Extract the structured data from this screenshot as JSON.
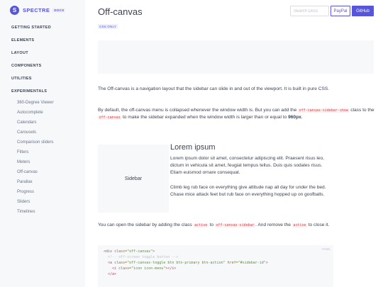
{
  "brand": {
    "logo_letter": "S",
    "name": "SPECTRE",
    "badge": "DOCS"
  },
  "sidebar": {
    "sections": [
      "GETTING STARTED",
      "ELEMENTS",
      "LAYOUT",
      "COMPONENTS",
      "UTILITIES",
      "EXPERIMENTALS"
    ],
    "items": [
      "360-Degree Viewer",
      "Autocomplete",
      "Calendars",
      "Carousels",
      "Comparison sliders",
      "Filters",
      "Meters",
      "Off-canvas",
      "Parallax",
      "Progress",
      "Sliders",
      "Timelines"
    ]
  },
  "header": {
    "search_placeholder": "Search Docs",
    "paypal_label": "PayPal",
    "github_label": "GitHub"
  },
  "main": {
    "title": "Off-canvas",
    "badge": "CSS ONLY",
    "intro": "The Off-canvas is a navigation layout that the sidebar can slide in and out of the viewport. It is built in pure CSS.",
    "default_p1": "By default, the off-canvas menu is collapsed whenever the window width is. But you can add the",
    "default_code1": "off-canvas-sidebar-show",
    "default_p2": "class to the",
    "default_code2": "off-canvas",
    "default_p3": "to make the sidebar expanded when the window width is larger than or equal to",
    "default_bold": "960px",
    "default_p4": ".",
    "demo": {
      "sidebar_label": "Sidebar",
      "heading": "Lorem ipsum",
      "p1": "Lorem ipsum dolor sit amet, consectetur adipiscing elit. Praesent risus leo, dictum in vehicula sit amet, feugiat tempus tellus. Duis quis sodales risus. Etiam euismod ornare consequat.",
      "p2": "Climb leg rub face on everything give attitude nap all day for under the bed. Chase mice attack feet but rub face on everything hopped up on goofballs."
    },
    "open_p1": "You can open the sidebar by adding the class",
    "open_code1": "active",
    "open_p2": "to",
    "open_code2": "off-canvas-sidebar",
    "open_p3": ". And remove the",
    "open_code3": "active",
    "open_p4": "to close it.",
    "code": {
      "lang": "HTML",
      "line1_open": "<div ",
      "line1_attr": "class=",
      "line1_val": "\"off-canvas\"",
      "line1_close": ">",
      "line2": "  <!-- off-screen toggle button -->",
      "line3_open": "  <a ",
      "line3_attr": "class=",
      "line3_val": "\"off-canvas-toggle btn btn-primary btn-action\"",
      "line3_attr2": " href=",
      "line3_val2": "\"#sidebar-id\"",
      "line3_close": ">",
      "line4_open": "    <i ",
      "line4_attr": "class=",
      "line4_val": "\"icon icon-menu\"",
      "line4_close": "></i>",
      "line5": "  </a>"
    }
  }
}
